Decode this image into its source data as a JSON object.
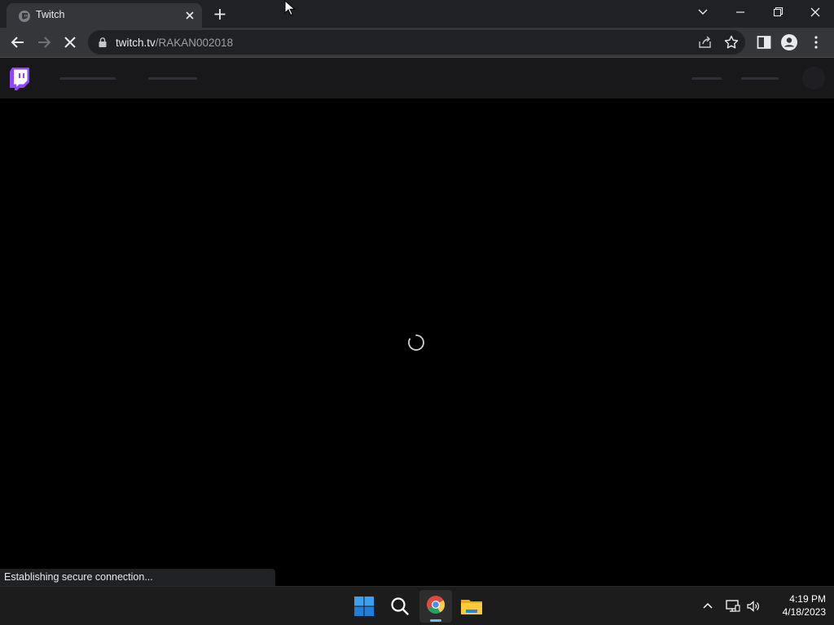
{
  "browser": {
    "tab": {
      "title": "Twitch",
      "favicon": "twitch-favicon-icon"
    },
    "url": {
      "host": "twitch.tv",
      "path": "/RAKAN002018"
    },
    "status_text": "Establishing secure connection...",
    "icons": {
      "back": "arrow-left-icon",
      "forward": "arrow-right-icon",
      "stop": "close-icon",
      "lock": "lock-icon",
      "share": "share-icon",
      "bookmark": "star-icon",
      "side_panel": "side-panel-icon",
      "profile": "person-icon",
      "menu": "kebab-menu-icon"
    }
  },
  "twitch": {
    "brand_color": "#9146ff",
    "nav_background": "#18181b",
    "loading": true
  },
  "taskbar": {
    "time": "4:19 PM",
    "date": "4/18/2023",
    "apps": [
      "windows-start-icon",
      "search-icon",
      "chrome-icon",
      "file-explorer-icon"
    ],
    "tray": [
      "chevron-up-icon",
      "network-icon",
      "volume-icon"
    ]
  },
  "colors": {
    "titlebar": "#202124",
    "toolbar": "#35363a",
    "omnibox": "#202124",
    "taskbar": "#1c1c1c",
    "accent": "#76b9ed"
  }
}
